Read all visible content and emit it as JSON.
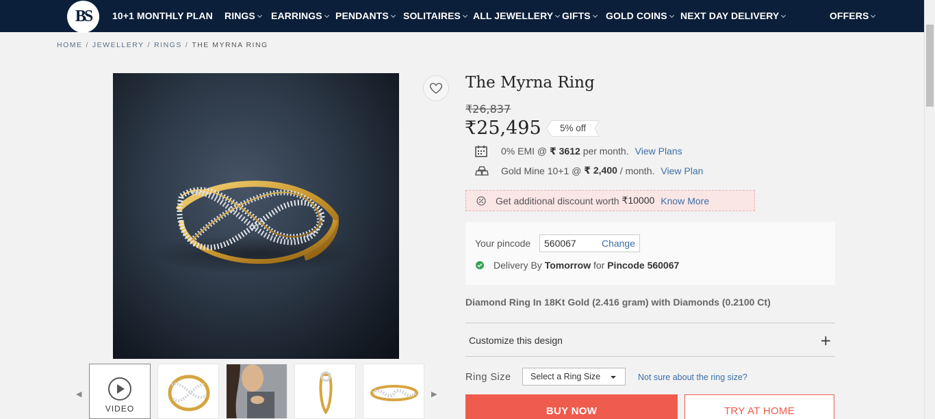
{
  "brand": {
    "logo_text": "BS",
    "icon": "brand-logo-icon"
  },
  "nav": {
    "items": [
      {
        "label": "10+1 MONTHLY PLAN",
        "has_caret": false
      },
      {
        "label": "RINGS",
        "has_caret": true
      },
      {
        "label": "EARRINGS",
        "has_caret": true
      },
      {
        "label": "PENDANTS",
        "has_caret": true
      },
      {
        "label": "SOLITAIRES",
        "has_caret": true
      },
      {
        "label": "ALL JEWELLERY",
        "has_caret": true
      },
      {
        "label": "GIFTS",
        "has_caret": true
      },
      {
        "label": "GOLD COINS",
        "has_caret": true
      },
      {
        "label": "NEXT DAY DELIVERY",
        "has_caret": true
      },
      {
        "label": "OFFERS",
        "has_caret": true
      }
    ]
  },
  "breadcrumb": {
    "home": "HOME",
    "jewellery": "JEWELLERY",
    "rings": "RINGS",
    "current": "THE MYRNA RING",
    "separator": "/"
  },
  "gallery": {
    "video_label": "VIDEO",
    "thumbnails": [
      "video",
      "ring-front",
      "model-wearing",
      "ring-side",
      "ring-top"
    ]
  },
  "product": {
    "title": "The Myrna Ring",
    "old_price": "₹26,837",
    "price": "₹25,495",
    "discount": "5% off",
    "emi": {
      "text": "0% EMI @",
      "amount": "₹ 3612",
      "suffix": "per month.",
      "link": "View Plans"
    },
    "gold_mine": {
      "text": "Gold Mine 10+1 @",
      "amount": "₹ 2,400",
      "suffix": "/ month.",
      "link": "View Plan"
    },
    "offer": {
      "text": "Get additional discount worth",
      "amount": "₹10000",
      "link": "Know More"
    },
    "pincode": {
      "label": "Your pincode",
      "value": "560067",
      "change": "Change",
      "delivery_prefix": "Delivery By",
      "delivery_day": "Tomorrow",
      "delivery_mid": "for",
      "delivery_pin": "Pincode 560067"
    },
    "description": "Diamond Ring In 18Kt Gold (2.416 gram) with Diamonds (0.2100 Ct)",
    "customize": "Customize this design",
    "ring_size": {
      "label": "Ring Size",
      "selected": "Select a Ring Size",
      "help": "Not sure about the ring size?"
    },
    "buy_now": "BUY NOW",
    "try_at_home": "TRY AT HOME"
  },
  "colors": {
    "nav_bg": "#0b1f3a",
    "accent": "#ef5b4c",
    "link": "#3b6ea8",
    "success": "#3aa35b"
  }
}
